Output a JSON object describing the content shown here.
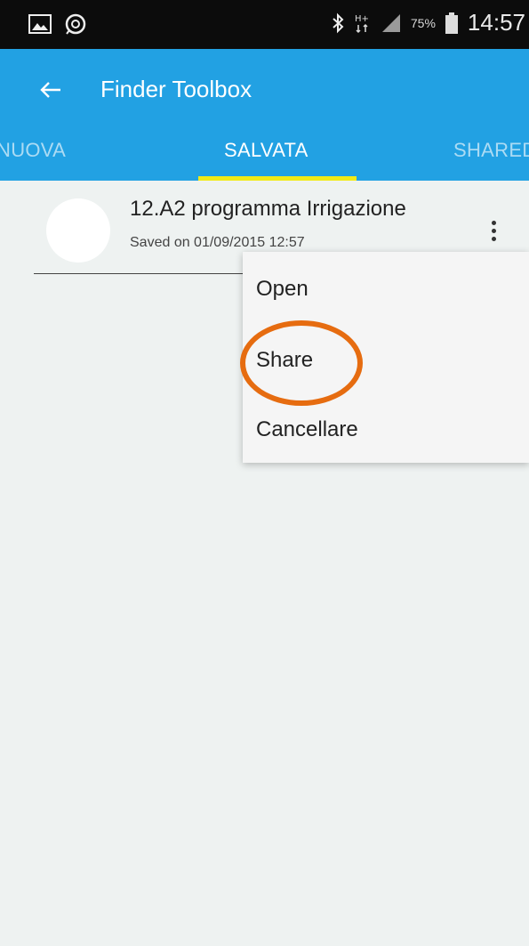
{
  "status_bar": {
    "icons": [
      "image-icon",
      "sync-icon",
      "bluetooth-icon",
      "hplus-signal-icon",
      "signal-icon",
      "battery-icon"
    ],
    "battery_percent": "75%",
    "time": "14:57"
  },
  "app_bar": {
    "back_icon": "arrow-left-icon",
    "title": "Finder Toolbox",
    "color": "#22a1e3"
  },
  "tabs": {
    "items": [
      {
        "label": "NUOVA"
      },
      {
        "label": "SALVATA",
        "active": true
      },
      {
        "label": "SHARED"
      }
    ],
    "indicator_color": "#f2ea17"
  },
  "list": {
    "items": [
      {
        "title": "12.A2   programma Irrigazione",
        "subtitle": "Saved on 01/09/2015 12:57"
      }
    ]
  },
  "context_menu": {
    "items": [
      {
        "label": "Open"
      },
      {
        "label": "Share"
      },
      {
        "label": "Cancellare"
      }
    ]
  },
  "annotation": {
    "color": "#e66c10",
    "target": "Share"
  }
}
